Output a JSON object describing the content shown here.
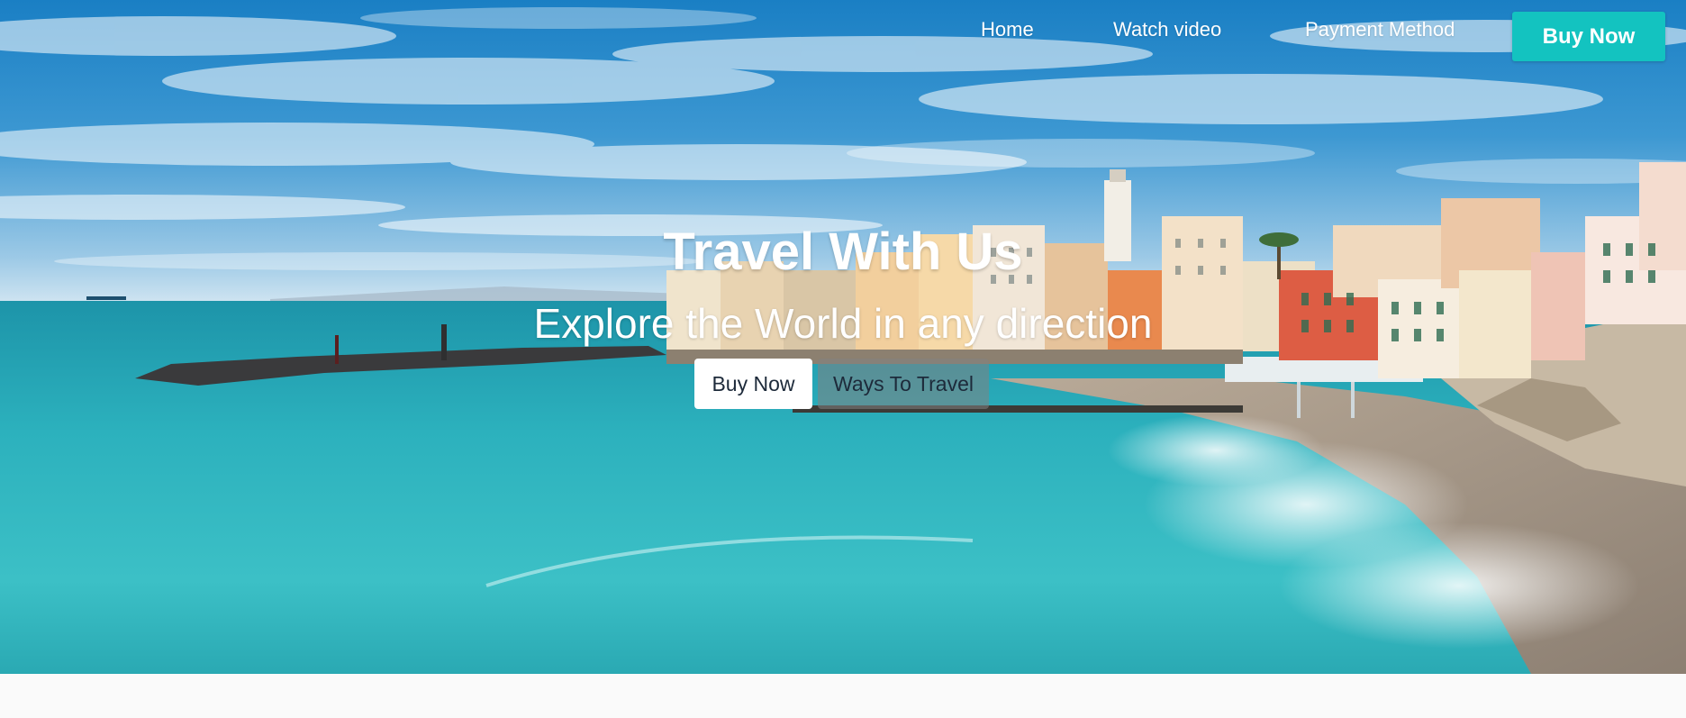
{
  "nav": {
    "links": [
      {
        "label": "Home"
      },
      {
        "label": "Watch video"
      },
      {
        "label": "Payment Method"
      }
    ],
    "cta_label": "Buy Now",
    "cta_color": "#13c3c0"
  },
  "hero": {
    "title": "Travel With Us",
    "subtitle": "Explore the World in any direction",
    "primary_button": "Buy Now",
    "secondary_button": "Ways To Travel",
    "background_image": "coastal-town-photo"
  }
}
